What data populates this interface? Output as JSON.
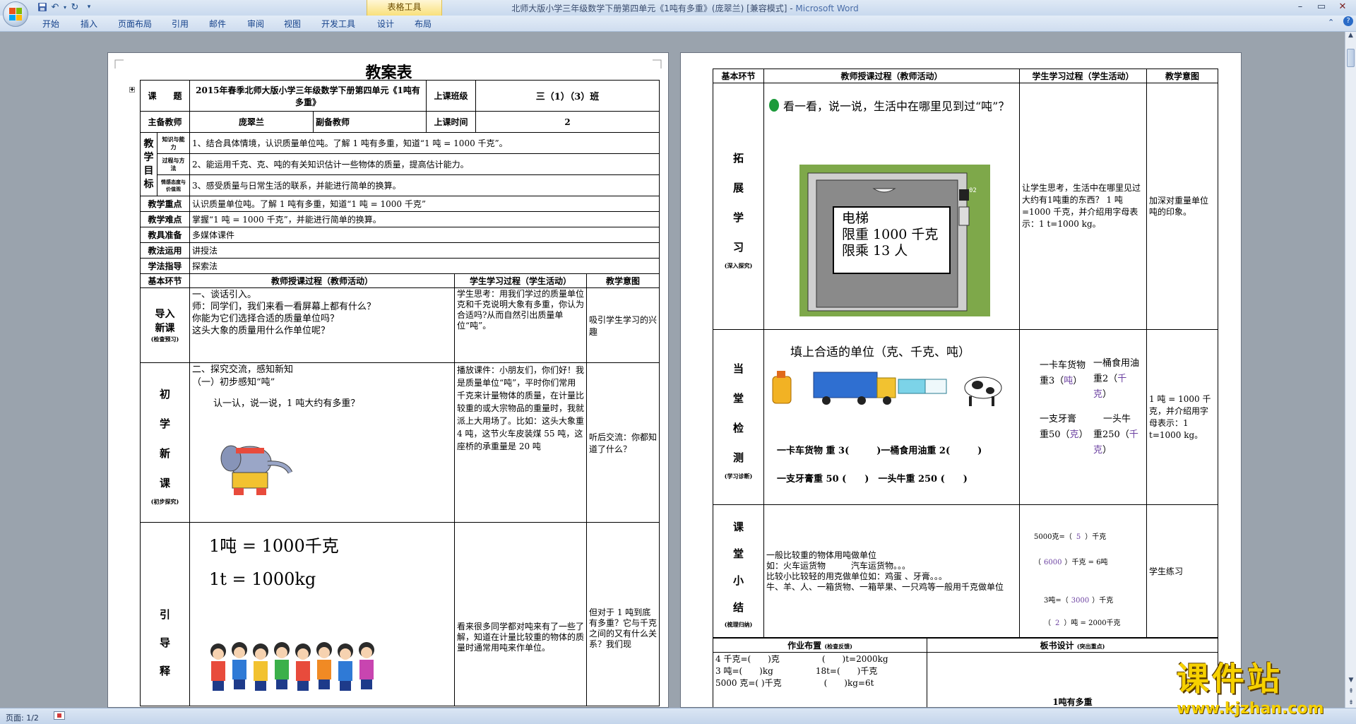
{
  "window": {
    "title_main": "北师大版小学三年级数学下册第四单元《1吨有多重》(庞翠兰) [兼容模式] - ",
    "title_app": "Microsoft Word",
    "context_tab": "表格工具"
  },
  "ribbon": {
    "tabs": [
      "开始",
      "插入",
      "页面布局",
      "引用",
      "邮件",
      "审阅",
      "视图",
      "开发工具",
      "设计",
      "布局"
    ]
  },
  "status": {
    "page": "页面: 1/2"
  },
  "page1": {
    "title": "教案表",
    "lesson_label": "课　　题",
    "lesson_value": "2015年春季北师大版小学三年级数学下册第四单元《1吨有多重》",
    "class_label": "上课班级",
    "class_value": "三（1）（3）班",
    "teacher_label": "主备教师",
    "teacher_value": "庞翠兰",
    "vice_label": "副备教师",
    "time_label": "上课时间",
    "time_value": "2",
    "goal_label": [
      "教",
      "学",
      "目",
      "标"
    ],
    "goal_sub": [
      "知识与能力",
      "过程与方法",
      "情感态度与价值观"
    ],
    "goals": [
      "1、结合具体情境，认识质量单位吨。了解 1 吨有多重，知道“1 吨 = 1000 千克”。",
      "2、能运用千克、克、吨的有关知识估计一些物体的质量，提高估计能力。",
      "3、感受质量与日常生活的联系，并能进行简单的换算。"
    ],
    "rows": [
      {
        "label": "教学重点",
        "value": "认识质量单位吨。了解 1 吨有多重，知道“1 吨 = 1000 千克”"
      },
      {
        "label": "教学难点",
        "value": "掌握“1 吨 = 1000 千克”，并能进行简单的换算。"
      },
      {
        "label": "教具准备",
        "value": "多媒体课件"
      },
      {
        "label": "教法运用",
        "value": "讲授法"
      },
      {
        "label": "学法指导",
        "value": "探索法"
      }
    ],
    "head": {
      "c1": "基本环节",
      "c2": "教师授课过程（教师活动）",
      "c3": "学生学习过程（学生活动）",
      "c4": "教学意图"
    },
    "sec1": {
      "label": "导入新课",
      "sub": "(检查预习)",
      "teacher": [
        "一、谈话引入。",
        "师：同学们，我们来看一看屏幕上都有什么？",
        "你能为它们选择合适的质量单位吗？",
        "这头大象的质量用什么作单位呢？"
      ],
      "student": "学生思考：用我们学过的质量单位克和千克说明大象有多重，你认为合适吗?从而自然引出质量单位“吨”。",
      "intent": "吸引学生学习的兴趣"
    },
    "sec2": {
      "label": "初学新课",
      "sub": "(初步探究)",
      "teacher": [
        "二、探究交流，感知新知",
        "（一）初步感知“吨”",
        "认一认，说一说，1 吨大约有多重？"
      ],
      "student": "播放课件：小朋友们，你们好！我是质量单位“吨”，平时你们常用千克来计量物体的质量，在计量比较重的或大宗物品的重量时，我就派上大用场了。比如：这头大象重 4 吨，这节火车皮装煤 55 吨，这座桥的承重量是 20 吨",
      "intent": "听后交流：你都知道了什么？"
    },
    "sec3": {
      "label": "引导释",
      "formula1": "1吨 = 1000千克",
      "formula2": "1t = 1000kg",
      "student": "看来很多同学都对吨来有了一些了解，知道在计量比较重的物体的质量时通常用吨来作单位。",
      "intent": "但对于 1 吨到底有多重？它与千克之间的又有什么关系？我们现"
    }
  },
  "page2": {
    "head": {
      "c1": "基本环节",
      "c2": "教师授课过程（教师活动）",
      "c3": "学生学习过程（学生活动）",
      "c4": "教学意图"
    },
    "sec1": {
      "label": "拓展学习",
      "sub": "(深入探究)",
      "prompt": "看一看，说一说，生活中在哪里见到过“吨”？",
      "sign": [
        "电梯",
        "限重 1000 千克",
        "限乘 13 人"
      ],
      "elevator_floor": "02",
      "student": "让学生思考，生活中在哪里见过大约有1吨重的东西？ 1 吨=1000 千克，并介绍用字母表示：1 t=1000 kg。",
      "intent": "加深对重量单位吨的印象。"
    },
    "sec2": {
      "label": "当堂检测",
      "sub": "(学习诊断)",
      "prompt": "填上合适的单位（克、千克、吨）",
      "q1": "一卡车货物 重 3(　　　)一桶食用油重 2(　　　)",
      "q2": "一支牙膏重 50 (　　)　一头牛重 250 (　　)",
      "answers": [
        {
          "t": "一卡车货物",
          "v": "重3（",
          "a": "吨",
          "e": "）"
        },
        {
          "t": "一桶食用油",
          "v": "重2（",
          "a": "千克",
          "e": "）"
        },
        {
          "t": "一支牙膏",
          "v": "重50（",
          "a": "克",
          "e": "）"
        },
        {
          "t": "一头牛",
          "v": "重250（",
          "a": "千克",
          "e": "）"
        }
      ],
      "intent": "1 吨 = 1000 千克，并介绍用字母表示：1 t=1000 kg。"
    },
    "sec3": {
      "label": "课堂小结",
      "sub": "(梳理归纳)",
      "teacher": [
        "一般比较重的物体用吨做单位",
        "如：火车运货物　　　汽车运货物。。。",
        "比较小比较轻的用克做单位如：鸡蛋 、牙膏。。。",
        "牛、羊、人、一箱货物、一箱苹果、一只鸡等一般用千克做单位"
      ],
      "calc": [
        {
          "a": "5000克=（",
          "v": "5",
          "b": "）千克"
        },
        {
          "a": "（",
          "v": "6000",
          "b": "）千克 = 6吨"
        },
        {
          "a": "3吨=（",
          "v": "3000",
          "b": "）千克"
        },
        {
          "a": "（",
          "v": "2",
          "b": "）吨 = 2000千克"
        }
      ],
      "intent": "学生练习"
    },
    "hw": {
      "label": "作业布置",
      "label_sub": "(检查反馈)",
      "board": "板书设计",
      "board_sub": "(突出重点)",
      "lines": [
        "4 千克=(　　)克　　　　　(　　)t=2000kg",
        "3 吨=(　　)kg　　　　　18t=(　　)千克",
        "5000 克=( )千克　　　　　(　　)kg=6t"
      ],
      "board_title": "1吨有多重"
    }
  },
  "watermark": {
    "t1": "课件站",
    "t2": "www.kjzhan.com"
  },
  "colors": {
    "title_text": "#3b4d6e",
    "ribbon_text": "#15428b",
    "answer": "#6a3fa0",
    "bubble_green": "#1c9a3a"
  }
}
